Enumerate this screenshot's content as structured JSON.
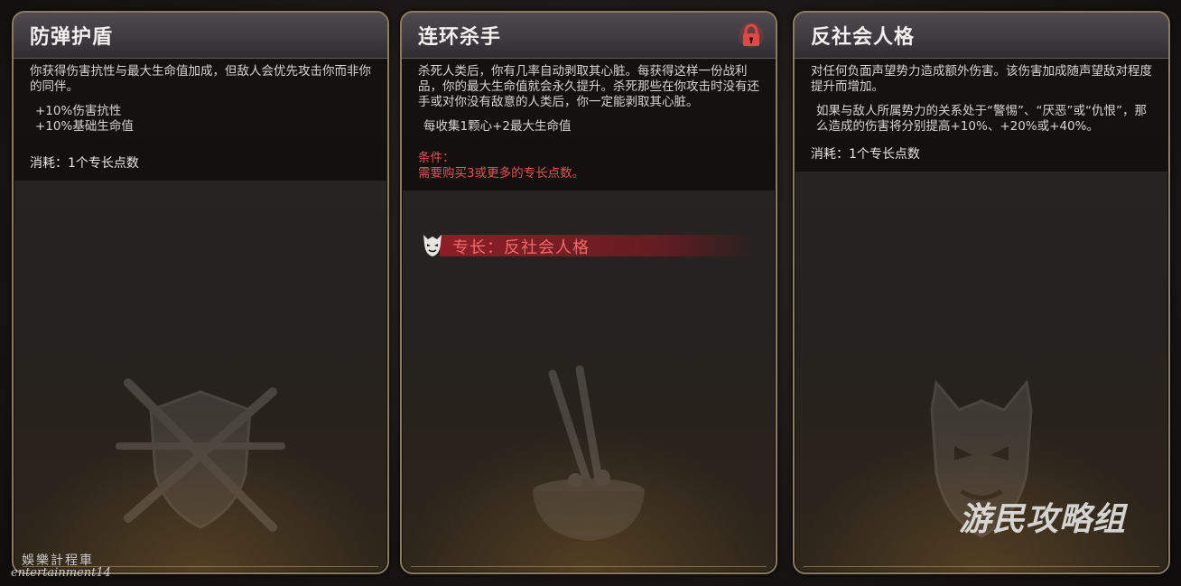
{
  "cards": [
    {
      "title": "防弹护盾",
      "description": "你获得伤害抗性与最大生命值加成，但敌人会优先攻击你而非你的同伴。",
      "bonuses": [
        "+10%伤害抗性",
        "+10%基础生命值"
      ],
      "cost": "消耗：1个专长点数",
      "emblem_icon": "shield-crossed-sticks-icon"
    },
    {
      "title": "连环杀手",
      "description": "杀死人类后，你有几率自动剥取其心脏。每获得这样一份战利品，你的最大生命值就会永久提升。杀死那些在你攻击时没有还手或对你没有敌意的人类后，你一定能剥取其心脏。",
      "bonus": "每收集1颗心+2最大生命值",
      "condition_label": "条件：",
      "condition_text": "需要购买3或更多的专长点数。",
      "locked_icon": "lock-icon",
      "required_perk": "专长：反社会人格",
      "emblem_icon": "bowl-chopsticks-icon"
    },
    {
      "title": "反社会人格",
      "description": "对任何负面声望势力造成额外伤害。该伤害加成随声望敌对程度提升而增加。",
      "detail": "如果与敌人所属势力的关系处于“警惕”、“厌恶”或“仇恨”，那么造成的伤害将分别提高+10%、+20%或+40%。",
      "cost": "消耗：1个专长点数",
      "emblem_icon": "demon-mask-shield-icon"
    }
  ],
  "watermarks": {
    "right": "游民攻略组",
    "left_cn": "娛樂計程車",
    "left_en": "entertainment14"
  },
  "colors": {
    "condition_red": "#e05555",
    "perk_red": "#f06a6a",
    "border_gold": "#8a7a60"
  }
}
